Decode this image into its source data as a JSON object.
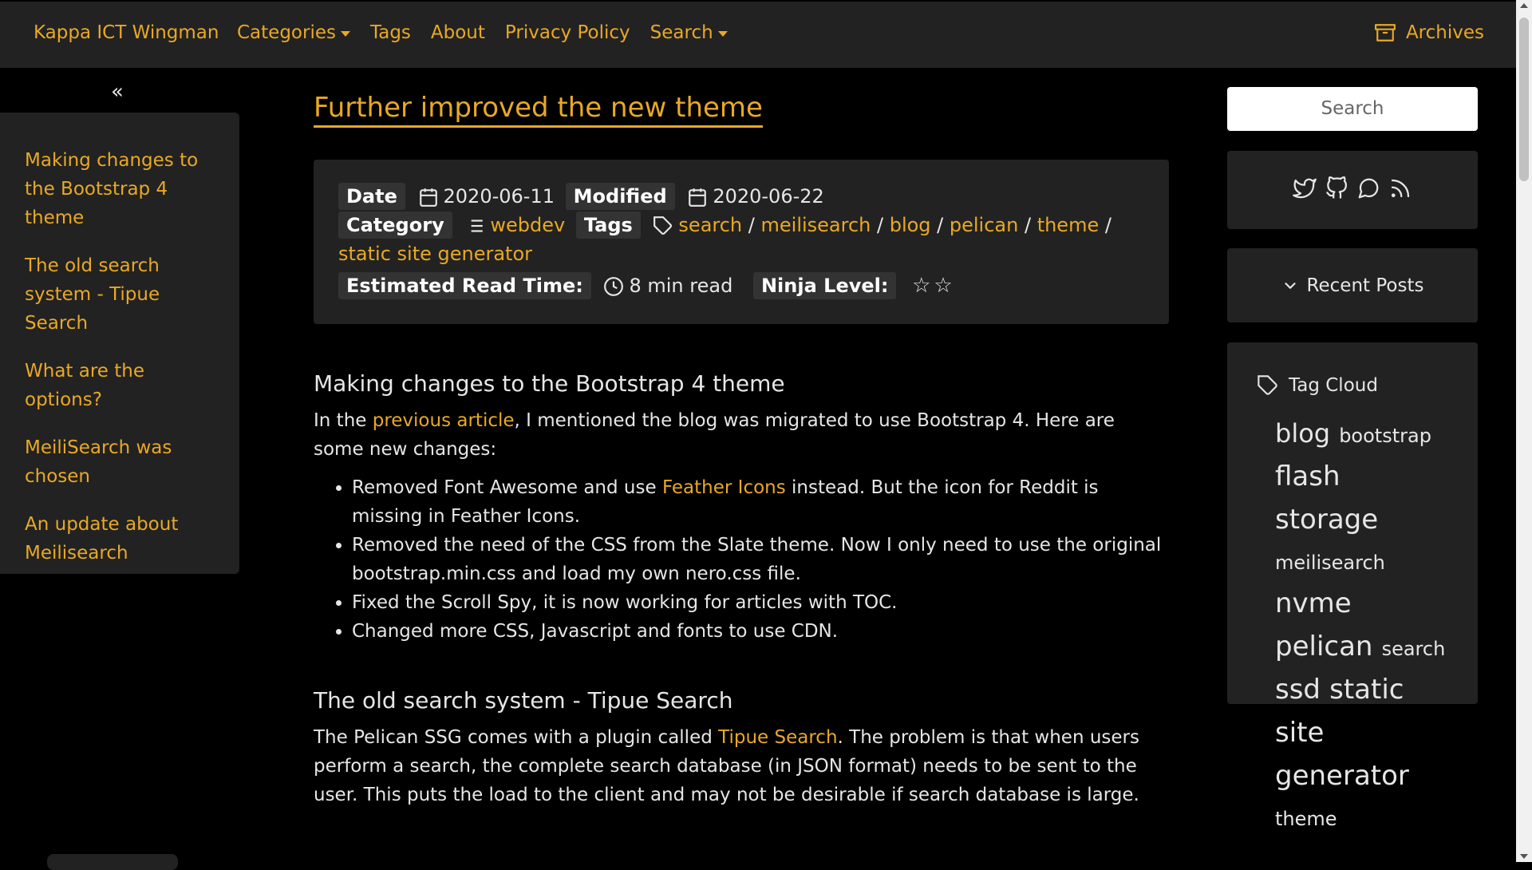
{
  "nav": {
    "brand": "Kappa ICT Wingman",
    "links": [
      "Categories",
      "Tags",
      "About",
      "Privacy Policy",
      "Search"
    ],
    "archives": "Archives"
  },
  "toc": {
    "toggle": "«",
    "items": [
      "Making changes to the Bootstrap 4 theme",
      "The old search system - Tipue Search",
      "What are the options?",
      "MeiliSearch was chosen",
      "An update about Meilisearch"
    ]
  },
  "article": {
    "title": "Further improved the new theme",
    "meta": {
      "date_label": "Date",
      "date": "2020-06-11",
      "modified_label": "Modified",
      "modified": "2020-06-22",
      "category_label": "Category",
      "category": "webdev",
      "tags_label": "Tags",
      "tags": [
        "search",
        "meilisearch",
        "blog",
        "pelican",
        "theme",
        "static site generator"
      ],
      "read_label": "Estimated Read Time:",
      "read_time": "8 min read",
      "ninja_label": "Ninja Level:",
      "ninja_stars": 2
    },
    "section1": {
      "heading": "Making changes to the Bootstrap 4 theme",
      "p_before": "In the ",
      "p_link": "previous article",
      "p_after": ", I mentioned the blog was migrated to use Bootstrap 4. Here are some new changes:",
      "b1_before": "Removed Font Awesome and use ",
      "b1_link": "Feather Icons",
      "b1_after": " instead. But the icon for Reddit is missing in Feather Icons.",
      "b2": "Removed the need of the CSS from the Slate theme. Now I only need to use the original bootstrap.min.css and load my own nero.css file.",
      "b3": "Fixed the Scroll Spy, it is now working for articles with TOC.",
      "b4": "Changed more CSS, Javascript and fonts to use CDN."
    },
    "section2": {
      "heading": "The old search system - Tipue Search",
      "p_before": "The Pelican SSG comes with a plugin called ",
      "p_link": "Tipue Search",
      "p_after": ". The problem is that when users perform a search, the complete search database (in JSON format) needs to be sent to the user. This puts the load to the client and may not be desirable if search database is large."
    }
  },
  "sidebar": {
    "search_placeholder": "Search",
    "social_icons": [
      "twitter-icon",
      "github-icon",
      "message-circle-icon",
      "rss-icon"
    ],
    "recent_posts": "Recent Posts",
    "tag_cloud_title": "Tag Cloud",
    "tag_cloud": [
      "blog",
      "bootstrap",
      "flash storage",
      "meilisearch",
      "nvme",
      "pelican",
      "search",
      "ssd",
      "static site generator",
      "theme"
    ]
  },
  "colors": {
    "accent": "#e9a826",
    "background": "#000000",
    "panel": "#222222"
  }
}
